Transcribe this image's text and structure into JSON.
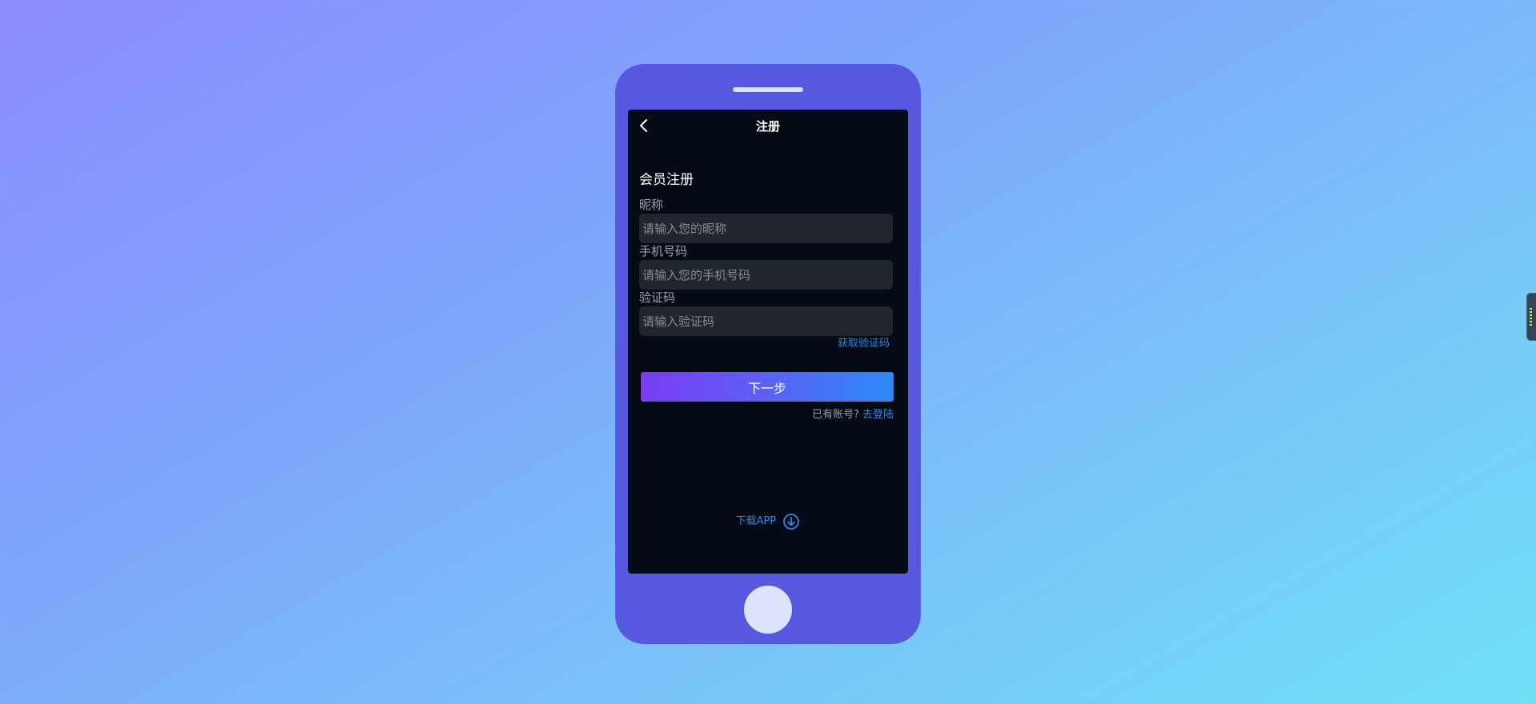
{
  "nav": {
    "title": "注册",
    "back_icon": "chevron-left-icon"
  },
  "form": {
    "title": "会员注册",
    "nickname": {
      "label": "昵称",
      "placeholder": "请输入您的昵称",
      "value": ""
    },
    "phone": {
      "label": "手机号码",
      "placeholder": "请输入您的手机号码",
      "value": ""
    },
    "code": {
      "label": "验证码",
      "placeholder": "请输入验证码",
      "value": "",
      "get_code_label": "获取验证码"
    },
    "next_label": "下一步"
  },
  "login": {
    "hint": "已有账号?",
    "link_label": "去登陆"
  },
  "download": {
    "label": "下载APP",
    "icon": "download-circle-icon"
  },
  "colors": {
    "accent": "#2a87e8",
    "phone_body": "#5659df",
    "screen_bg": "#050b14",
    "button_gradient_start": "#7a3cf3",
    "button_gradient_end": "#2c8af7"
  }
}
